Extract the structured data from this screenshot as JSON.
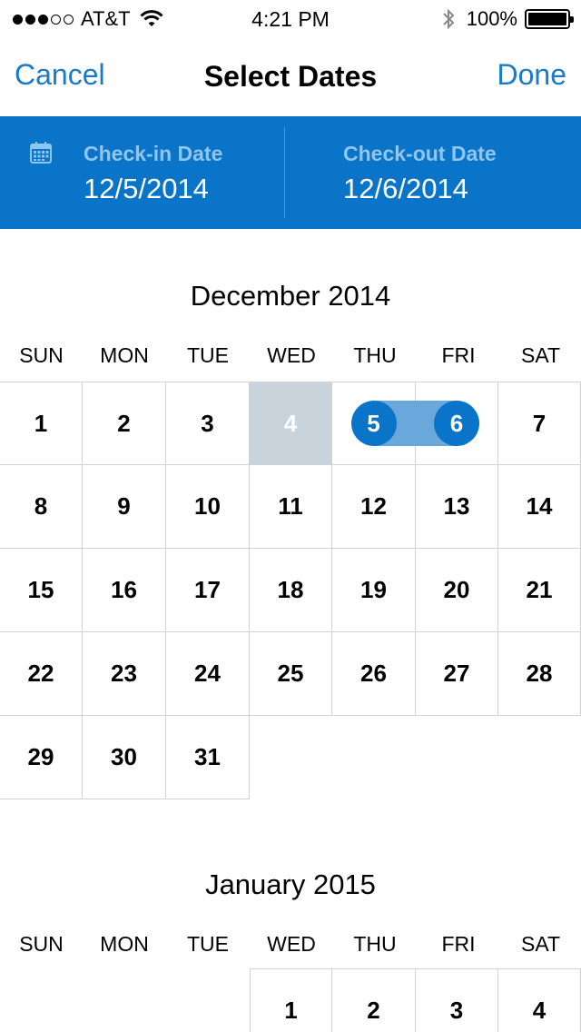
{
  "status_bar": {
    "carrier": "AT&T",
    "time": "4:21 PM",
    "battery": "100%"
  },
  "nav": {
    "cancel": "Cancel",
    "title": "Select Dates",
    "done": "Done"
  },
  "dates": {
    "checkin_label": "Check-in Date",
    "checkin_value": "12/5/2014",
    "checkout_label": "Check-out Date",
    "checkout_value": "12/6/2014"
  },
  "months": [
    {
      "title": "December 2014",
      "weekdays": [
        "SUN",
        "MON",
        "TUE",
        "WED",
        "THU",
        "FRI",
        "SAT"
      ],
      "days": [
        "1",
        "2",
        "3",
        "4",
        "5",
        "6",
        "7",
        "8",
        "9",
        "10",
        "11",
        "12",
        "13",
        "14",
        "15",
        "16",
        "17",
        "18",
        "19",
        "20",
        "21",
        "22",
        "23",
        "24",
        "25",
        "26",
        "27",
        "28",
        "29",
        "30",
        "31"
      ]
    },
    {
      "title": "January 2015",
      "weekdays": [
        "SUN",
        "MON",
        "TUE",
        "WED",
        "THU",
        "FRI",
        "SAT"
      ],
      "days": [
        "1",
        "2",
        "3",
        "4"
      ]
    }
  ],
  "colors": {
    "accent": "#0a74c8",
    "link": "#1a7ac8",
    "range": "#6aa8dc",
    "past": "#c9d3db"
  }
}
